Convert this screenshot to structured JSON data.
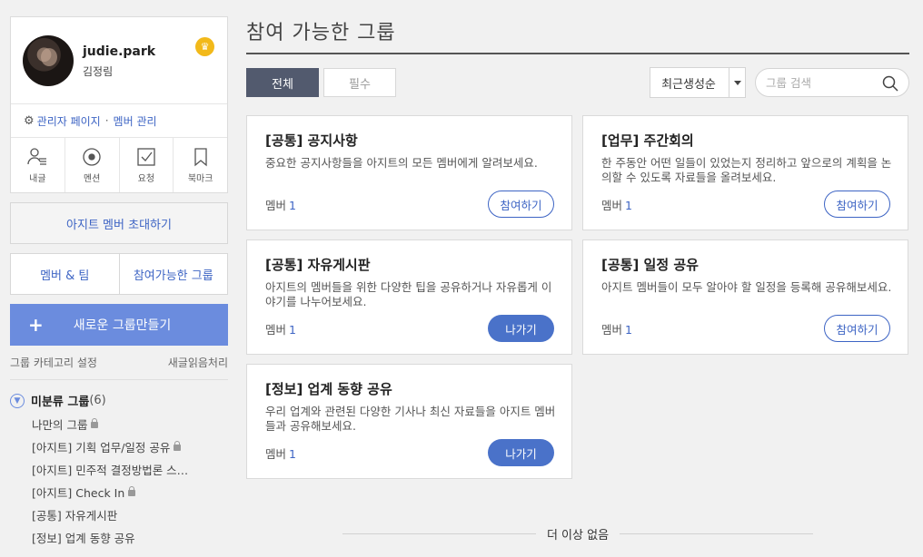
{
  "profile": {
    "username": "judie.park",
    "name": "김정림",
    "admin_link": "관리자 페이지",
    "member_link": "멤버 관리",
    "quick_menu": [
      {
        "label": "내글",
        "icon": "person-list-icon"
      },
      {
        "label": "멘션",
        "icon": "mention-circle-icon"
      },
      {
        "label": "요청",
        "icon": "checkbox-icon"
      },
      {
        "label": "북마크",
        "icon": "bookmark-icon"
      }
    ]
  },
  "sidebar": {
    "invite_label": "아지트 멤버 초대하기",
    "tabs": [
      "멤버 & 팀",
      "참여가능한 그룹"
    ],
    "create_label": "새로운 그룹만들기",
    "category_settings": "그룹 카테고리 설정",
    "mark_read": "새글읽음처리",
    "folder": {
      "name": "미분류 그룹",
      "count": "(6)"
    },
    "groups": [
      {
        "name": "나만의 그룹",
        "locked": true
      },
      {
        "name": "[아지트] 기획 업무/일정 공유",
        "locked": true
      },
      {
        "name": "[아지트] 민주적 결정방법론 스…",
        "locked": false
      },
      {
        "name": "[아지트] Check In",
        "locked": true
      },
      {
        "name": "[공통] 자유게시판",
        "locked": false
      },
      {
        "name": "[정보] 업계 동향 공유",
        "locked": false
      }
    ]
  },
  "main": {
    "title": "참여 가능한 그룹",
    "filter_all": "전체",
    "filter_required": "필수",
    "sort_value": "최근생성순",
    "search_placeholder": "그룹 검색",
    "member_label": "멤버",
    "end_text": "더 이상 없음",
    "cards": [
      {
        "title": "[공통] 공지사항",
        "desc": "중요한 공지사항들을 아지트의 모든 멤버에게 알려보세요.",
        "members": "1",
        "button": "참여하기",
        "joined": false
      },
      {
        "title": "[업무] 주간회의",
        "desc": "한 주동안 어떤 일들이 있었는지 정리하고 앞으로의 계획을 논의할 수 있도록 자료들을 올려보세요.",
        "members": "1",
        "button": "참여하기",
        "joined": false
      },
      {
        "title": "[공통] 자유게시판",
        "desc": "아지트의 멤버들을 위한 다양한 팁을 공유하거나 자유롭게 이야기를 나누어보세요.",
        "members": "1",
        "button": "나가기",
        "joined": true
      },
      {
        "title": "[공통] 일정 공유",
        "desc": "아지트 멤버들이 모두 알아야 할 일정을 등록해 공유해보세요.",
        "members": "1",
        "button": "참여하기",
        "joined": false
      },
      {
        "title": "[정보] 업계 동향 공유",
        "desc": "우리 업계와 관련된 다양한 기사나 최신 자료들을 아지트 멤버들과 공유해보세요.",
        "members": "1",
        "button": "나가기",
        "joined": true
      }
    ]
  },
  "colors": {
    "accent": "#3d64c4",
    "create_button": "#6b8cde",
    "active_filter": "#525a6e",
    "crown": "#f2b91a"
  }
}
